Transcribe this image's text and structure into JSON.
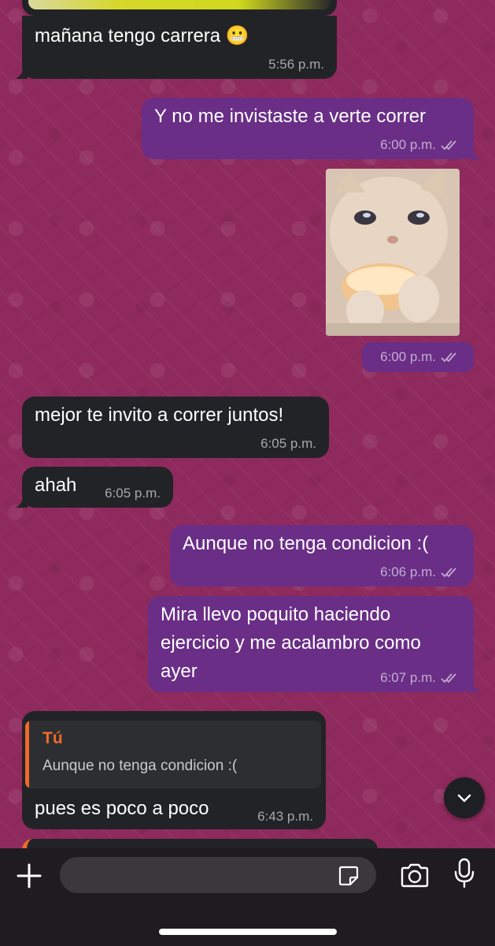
{
  "chat": {
    "messages": [
      {
        "text": "mañana tengo carrera 😬",
        "time": "5:56 p.m."
      },
      {
        "text": "Y no me invistaste a verte correr",
        "time": "6:00 p.m."
      },
      {
        "image": "crying-cat-eating-bread",
        "time": "6:00 p.m."
      },
      {
        "text": "mejor te invito a correr juntos!",
        "time": "6:05 p.m."
      },
      {
        "text": "ahah",
        "time": "6:05 p.m."
      },
      {
        "text": "Aunque no tenga condicion :(",
        "time": "6:06 p.m."
      },
      {
        "lines": [
          "Mira llevo poquito haciendo",
          "ejercicio y me acalambro como",
          "ayer"
        ],
        "time": "6:07 p.m."
      },
      {
        "reply": {
          "author": "Tú",
          "quoted": "Aunque no tenga condicion :("
        },
        "text": "pues es poco a poco",
        "time": "6:43 p.m."
      }
    ]
  },
  "colors": {
    "wallpaper": "#8e2a5d",
    "incoming_bubble": "#222326",
    "outgoing_bubble": "#6a2e87",
    "reply_accent": "#f0692c"
  },
  "composer": {
    "icons": [
      "plus-icon",
      "sticker-icon",
      "camera-icon",
      "microphone-icon"
    ]
  }
}
